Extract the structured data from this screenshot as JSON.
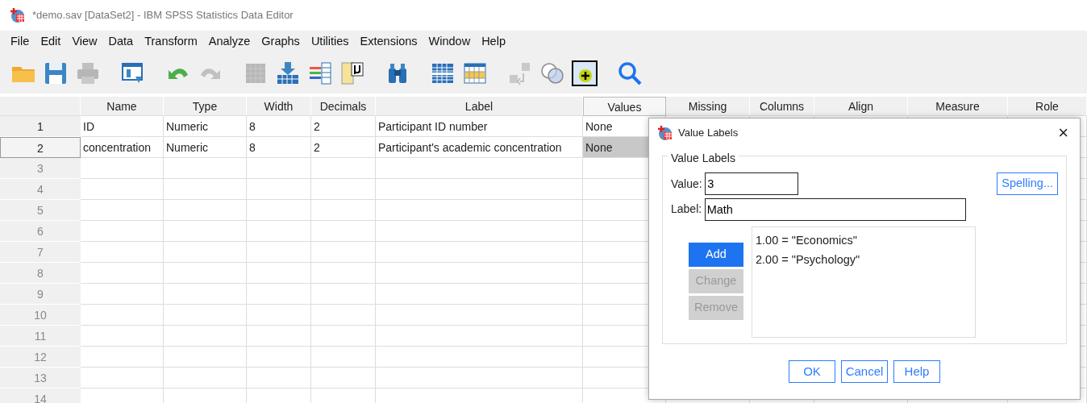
{
  "window": {
    "title": "*demo.sav [DataSet2] - IBM SPSS Statistics Data Editor"
  },
  "menu": [
    "File",
    "Edit",
    "View",
    "Data",
    "Transform",
    "Analyze",
    "Graphs",
    "Utilities",
    "Extensions",
    "Window",
    "Help"
  ],
  "toolbar": [
    [
      {
        "kind": "open",
        "disabled": false
      },
      {
        "kind": "save",
        "disabled": false
      },
      {
        "kind": "print",
        "disabled": true
      }
    ],
    [
      {
        "kind": "dialog",
        "disabled": false
      }
    ],
    [
      {
        "kind": "undo",
        "disabled": false
      },
      {
        "kind": "redo",
        "disabled": true
      }
    ],
    [
      {
        "kind": "grid",
        "disabled": true
      },
      {
        "kind": "goto",
        "disabled": false
      },
      {
        "kind": "variables",
        "disabled": false
      },
      {
        "kind": "stats",
        "disabled": false
      }
    ],
    [
      {
        "kind": "find",
        "disabled": false
      }
    ],
    [
      {
        "kind": "split",
        "disabled": false
      },
      {
        "kind": "weight",
        "disabled": false
      }
    ],
    [
      {
        "kind": "swap",
        "disabled": true
      },
      {
        "kind": "sets",
        "disabled": false
      },
      {
        "kind": "addon",
        "disabled": false
      }
    ],
    [
      {
        "kind": "search",
        "disabled": false
      }
    ]
  ],
  "table": {
    "columns": [
      {
        "label": "Name",
        "selected": false
      },
      {
        "label": "Type",
        "selected": false
      },
      {
        "label": "Width",
        "selected": false
      },
      {
        "label": "Decimals",
        "selected": false
      },
      {
        "label": "Label",
        "selected": false
      },
      {
        "label": "Values",
        "selected": true
      },
      {
        "label": "Missing",
        "selected": false
      },
      {
        "label": "Columns",
        "selected": false
      },
      {
        "label": "Align",
        "selected": false
      },
      {
        "label": "Measure",
        "selected": false
      },
      {
        "label": "Role",
        "selected": false
      }
    ],
    "rows": [
      {
        "number": "1",
        "selected": false,
        "cells": [
          "ID",
          "Numeric",
          "8",
          "2",
          "Participant ID number",
          "None"
        ]
      },
      {
        "number": "2",
        "selected": true,
        "cells": [
          "concentration",
          "Numeric",
          "8",
          "2",
          "Participant's academic concentration",
          "None"
        ]
      },
      {
        "number": "3",
        "selected": false,
        "cells": []
      },
      {
        "number": "4",
        "selected": false,
        "cells": []
      },
      {
        "number": "5",
        "selected": false,
        "cells": []
      },
      {
        "number": "6",
        "selected": false,
        "cells": []
      },
      {
        "number": "7",
        "selected": false,
        "cells": []
      },
      {
        "number": "8",
        "selected": false,
        "cells": []
      },
      {
        "number": "9",
        "selected": false,
        "cells": []
      },
      {
        "number": "10",
        "selected": false,
        "cells": []
      },
      {
        "number": "11",
        "selected": false,
        "cells": []
      },
      {
        "number": "12",
        "selected": false,
        "cells": []
      },
      {
        "number": "13",
        "selected": false,
        "cells": []
      },
      {
        "number": "14",
        "selected": false,
        "cells": []
      }
    ]
  },
  "dialog": {
    "title": "Value Labels",
    "close": "×",
    "group_title": "Value Labels",
    "value_field": {
      "label": "Value:",
      "value": "3"
    },
    "label_field": {
      "label": "Label:",
      "value": "Math"
    },
    "spelling_button": "Spelling...",
    "side_buttons": [
      {
        "label": "Add",
        "primary": true,
        "disabled": false
      },
      {
        "label": "Change",
        "primary": false,
        "disabled": true
      },
      {
        "label": "Remove",
        "primary": false,
        "disabled": true
      }
    ],
    "labels": [
      "1.00 = \"Economics\"",
      "2.00 = \"Psychology\""
    ],
    "buttons": [
      "OK",
      "Cancel",
      "Help"
    ]
  }
}
